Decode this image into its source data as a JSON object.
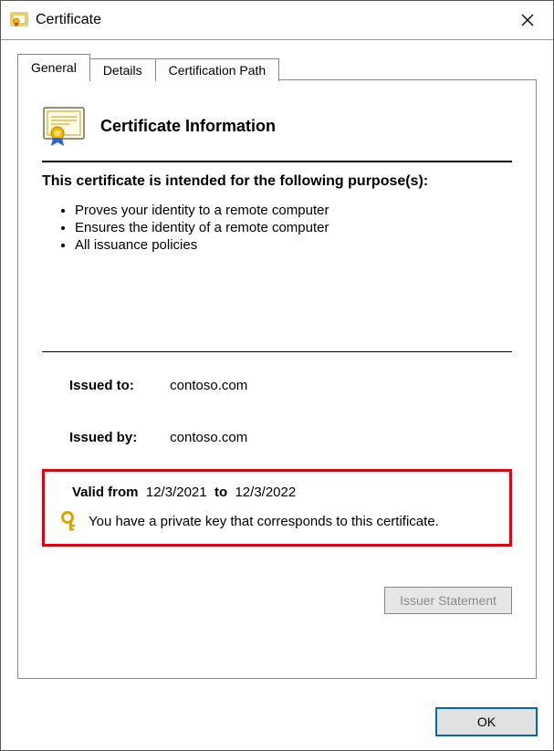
{
  "window": {
    "title": "Certificate"
  },
  "tabs": {
    "general": "General",
    "details": "Details",
    "certpath": "Certification Path"
  },
  "header": {
    "title": "Certificate Information"
  },
  "purpose_heading": "This certificate is intended for the following purpose(s):",
  "purposes": [
    "Proves your identity to a remote computer",
    "Ensures the identity of a remote computer",
    "All issuance policies"
  ],
  "issued_to": {
    "label": "Issued to:",
    "value": "contoso.com"
  },
  "issued_by": {
    "label": "Issued by:",
    "value": "contoso.com"
  },
  "validity": {
    "from_label": "Valid from",
    "from": "12/3/2021",
    "to_label": "to",
    "to": "12/3/2022"
  },
  "private_key_msg": "You have a private key that corresponds to this certificate.",
  "buttons": {
    "issuer_statement": "Issuer Statement",
    "ok": "OK"
  }
}
